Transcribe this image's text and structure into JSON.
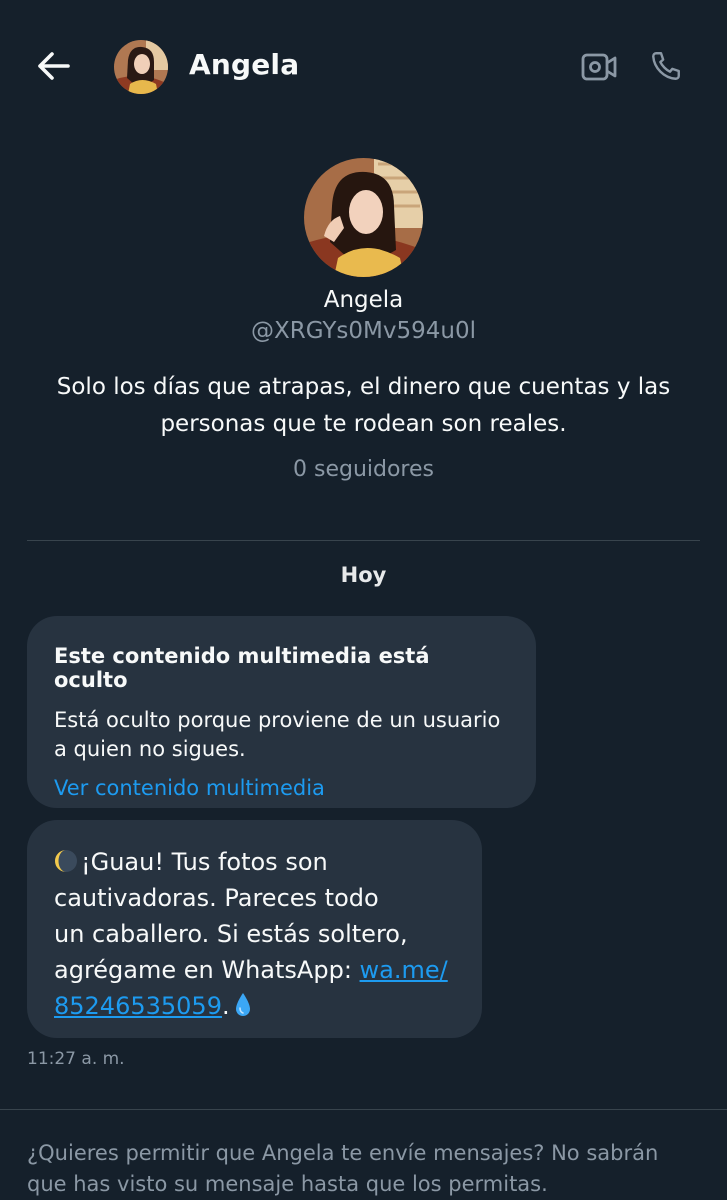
{
  "header": {
    "name": "Angela",
    "icons": {
      "back": "arrow-left-icon",
      "video": "video-call-icon",
      "phone": "phone-icon"
    }
  },
  "profile": {
    "name": "Angela",
    "handle": "@XRGYs0Mv594u0l",
    "bio": "Solo los días que atrapas, el dinero que cuentas y las personas que te rodean son reales.",
    "followers": "0 seguidores"
  },
  "conversation": {
    "date": "Hoy",
    "media_message": {
      "title": "Este contenido multimedia está oculto",
      "description": "Está oculto porque proviene de un usuario a quien no sigues.",
      "link": "Ver contenido multimedia"
    },
    "text_message": {
      "line1": "¡Guau! Tus fotos son",
      "line2": "cautivadoras. Pareces todo",
      "line3": "un caballero. Si estás soltero,",
      "line4_prefix": "agrégame en WhatsApp: ",
      "link_part1": "wa.me/",
      "link_part2": "85246535059",
      "suffix": ".",
      "emojis": [
        "crescent-moon",
        "droplet"
      ]
    },
    "timestamp": "11:27 a. m."
  },
  "request": {
    "text": "¿Quieres permitir que Angela te envíe mensajes? No sabrán que has visto su mensaje hasta que los permitas."
  },
  "colors": {
    "background": "#15202b",
    "bubble": "#273340",
    "link": "#1d9bf0",
    "secondary_text": "#8b98a5",
    "divider": "#38444d"
  }
}
